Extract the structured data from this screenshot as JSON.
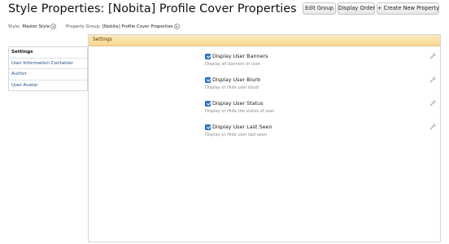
{
  "page": {
    "title": "Style Properties: [Nobita] Profile Cover Properties"
  },
  "toolbar": {
    "edit_group_label": "Edit Group",
    "display_order_label": "Display Order",
    "create_label": "+ Create New Property"
  },
  "filters": {
    "style_label": "Style:",
    "style_value": "Master Style",
    "group_label": "Property Group:",
    "group_value": "[Nobita] Profile Cover Properties"
  },
  "sidebar": {
    "items": [
      {
        "label": "Settings"
      },
      {
        "label": "User Information Container"
      },
      {
        "label": "Author"
      },
      {
        "label": "User Avatar"
      }
    ]
  },
  "panel": {
    "title": "Settings",
    "options": [
      {
        "label": "Display User Banners",
        "description": "Display all banners of user",
        "checked": true
      },
      {
        "label": "Display User Blurb",
        "description": "Display or Hide user blurb",
        "checked": true
      },
      {
        "label": "Display User Status",
        "description": "Display or Hide the status of user.",
        "checked": true
      },
      {
        "label": "Display User Last Seen",
        "description": "Display or Hide user last seen",
        "checked": true
      }
    ]
  },
  "icons": {
    "edit": "wrench-icon",
    "dropdown": "chevron-down-icon",
    "checkbox": "checkbox-checked-icon"
  },
  "colors": {
    "header_bg": "#f8d893",
    "link": "#234e80",
    "checkbox": "#2f80d6"
  }
}
